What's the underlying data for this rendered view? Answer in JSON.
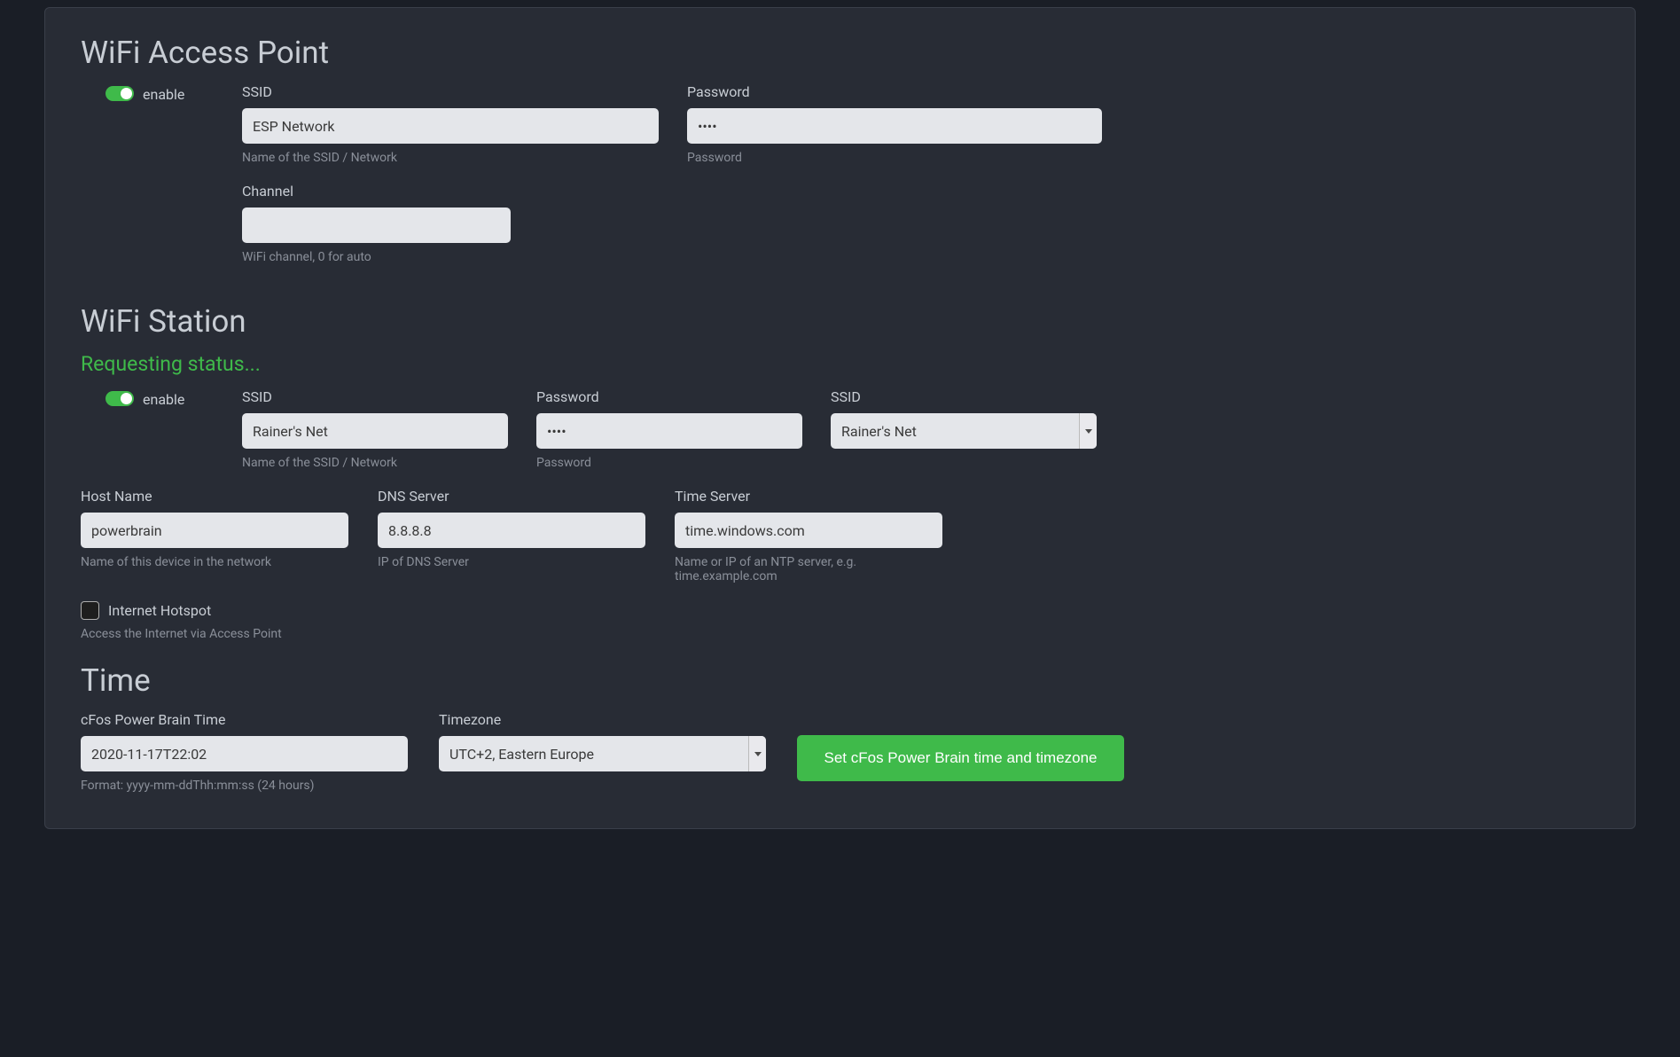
{
  "wifi_ap": {
    "heading": "WiFi Access Point",
    "enable_label": "enable",
    "enabled": true,
    "ssid": {
      "label": "SSID",
      "value": "ESP Network",
      "help": "Name of the SSID / Network"
    },
    "password": {
      "label": "Password",
      "value": "••••",
      "help": "Password"
    },
    "channel": {
      "label": "Channel",
      "value": "",
      "help": "WiFi channel, 0 for auto"
    }
  },
  "wifi_station": {
    "heading": "WiFi Station",
    "status": "Requesting status...",
    "enable_label": "enable",
    "enabled": true,
    "ssid": {
      "label": "SSID",
      "value": "Rainer's Net",
      "help": "Name of the SSID / Network"
    },
    "password": {
      "label": "Password",
      "value": "••••",
      "help": "Password"
    },
    "ssid_select": {
      "label": "SSID",
      "value": "Rainer's Net"
    },
    "host": {
      "label": "Host Name",
      "value": "powerbrain",
      "help": "Name of this device in the network"
    },
    "dns": {
      "label": "DNS Server",
      "value": "8.8.8.8",
      "help": "IP of DNS Server"
    },
    "timeserver": {
      "label": "Time Server",
      "value": "time.windows.com",
      "help": "Name or IP of an NTP server, e.g. time.example.com"
    },
    "hotspot": {
      "label": "Internet Hotspot",
      "help": "Access the Internet via Access Point",
      "checked": false
    }
  },
  "time": {
    "heading": "Time",
    "datetime": {
      "label": "cFos Power Brain Time",
      "value": "2020-11-17T22:02",
      "help": "Format: yyyy-mm-ddThh:mm:ss (24 hours)"
    },
    "timezone": {
      "label": "Timezone",
      "value": "UTC+2, Eastern Europe"
    },
    "button": "Set cFos Power Brain time and timezone"
  }
}
